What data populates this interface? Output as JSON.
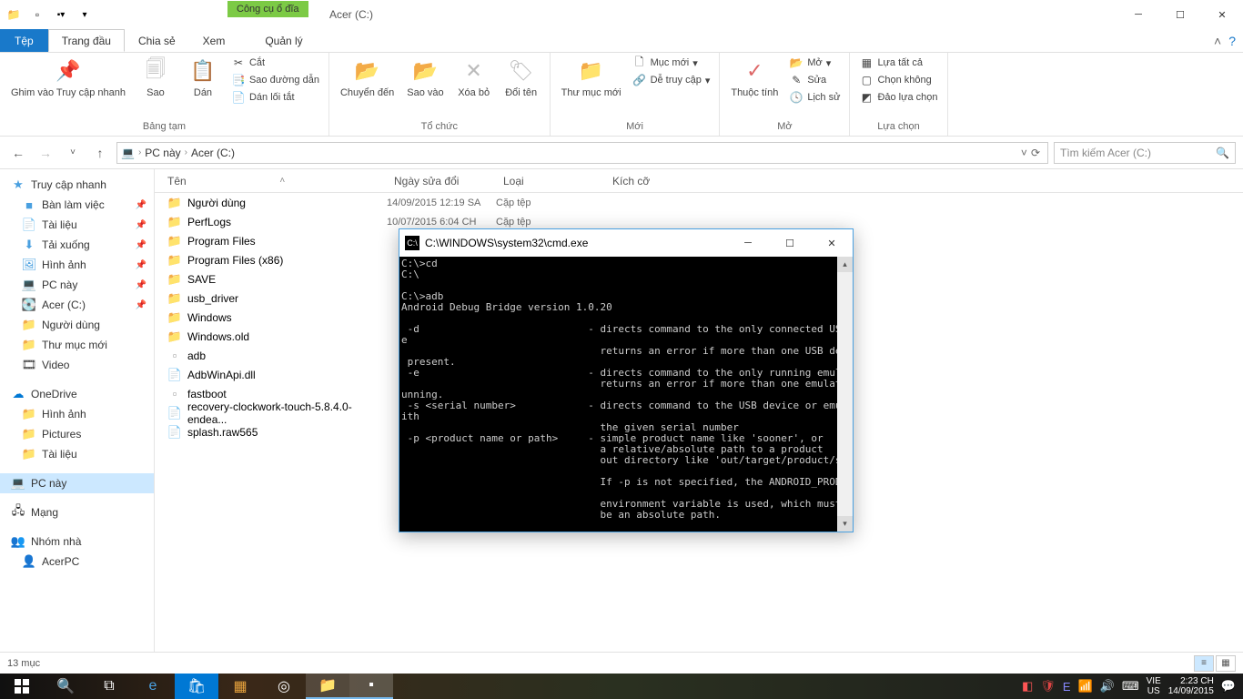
{
  "titlebar": {
    "drive_tools": "Công cụ ổ đĩa",
    "title": "Acer (C:)"
  },
  "tabs": {
    "file": "Tệp",
    "home": "Trang đầu",
    "share": "Chia sẻ",
    "view": "Xem",
    "manage": "Quản lý"
  },
  "ribbon": {
    "clipboard": {
      "title": "Bảng tạm",
      "pin": "Ghim vào Truy cập nhanh",
      "copy": "Sao",
      "paste": "Dán",
      "cut": "Cắt",
      "copy_path": "Sao đường dẫn",
      "paste_shortcut": "Dán lối tắt"
    },
    "organize": {
      "title": "Tổ chức",
      "move_to": "Chuyển đến",
      "copy_to": "Sao vào",
      "delete": "Xóa bỏ",
      "rename": "Đổi tên"
    },
    "new": {
      "title": "Mới",
      "new_folder": "Thư mục mới",
      "new_item": "Mục mới",
      "easy_access": "Dễ truy cập"
    },
    "open": {
      "title": "Mở",
      "properties": "Thuộc tính",
      "open": "Mở",
      "edit": "Sửa",
      "history": "Lịch sử"
    },
    "select": {
      "title": "Lựa chọn",
      "select_all": "Lựa tất cả",
      "select_none": "Chọn không",
      "invert": "Đảo lựa chọn"
    }
  },
  "breadcrumb": {
    "pc": "PC này",
    "drive": "Acer (C:)"
  },
  "search": {
    "placeholder": "Tìm kiếm Acer (C:)"
  },
  "sidebar": {
    "quick_access": "Truy cập nhanh",
    "desktop": "Bàn làm việc",
    "documents": "Tài liệu",
    "downloads": "Tải xuống",
    "pictures": "Hình ảnh",
    "this_pc": "PC này",
    "acer_c": "Acer (C:)",
    "users": "Người dùng",
    "new_folder": "Thư mục mới",
    "video": "Video",
    "onedrive": "OneDrive",
    "od_pictures": "Hình ảnh",
    "od_pictures2": "Pictures",
    "od_documents": "Tài liệu",
    "this_pc2": "PC này",
    "network": "Mạng",
    "homegroup": "Nhóm nhà",
    "acerpc": "AcerPC"
  },
  "columns": {
    "name": "Tên",
    "date": "Ngày sửa đổi",
    "type": "Loại",
    "size": "Kích cỡ"
  },
  "files": [
    {
      "name": "Người dùng",
      "date": "14/09/2015 12:19 SA",
      "type": "Cặp tệp",
      "icon": "folder"
    },
    {
      "name": "PerfLogs",
      "date": "10/07/2015 6:04 CH",
      "type": "Cặp tệp",
      "icon": "folder"
    },
    {
      "name": "Program Files",
      "date": "",
      "type": "",
      "icon": "folder"
    },
    {
      "name": "Program Files (x86)",
      "date": "",
      "type": "",
      "icon": "folder"
    },
    {
      "name": "SAVE",
      "date": "",
      "type": "",
      "icon": "folder"
    },
    {
      "name": "usb_driver",
      "date": "",
      "type": "",
      "icon": "folder"
    },
    {
      "name": "Windows",
      "date": "",
      "type": "",
      "icon": "folder"
    },
    {
      "name": "Windows.old",
      "date": "",
      "type": "",
      "icon": "folder"
    },
    {
      "name": "adb",
      "date": "",
      "type": "",
      "icon": "exe"
    },
    {
      "name": "AdbWinApi.dll",
      "date": "",
      "type": "",
      "icon": "file"
    },
    {
      "name": "fastboot",
      "date": "",
      "type": "",
      "icon": "exe"
    },
    {
      "name": "recovery-clockwork-touch-5.8.4.0-endea...",
      "date": "",
      "type": "",
      "icon": "file"
    },
    {
      "name": "splash.raw565",
      "date": "",
      "type": "",
      "icon": "file"
    }
  ],
  "status": {
    "count": "13 mục"
  },
  "cmd": {
    "title": "C:\\WINDOWS\\system32\\cmd.exe",
    "text": "C:\\>cd\nC:\\\n\nC:\\>adb\nAndroid Debug Bridge version 1.0.20\n\n -d                            - directs command to the only connected USB devic\ne\n                                 returns an error if more than one USB device is\n present.\n -e                            - directs command to the only running emulator.\n                                 returns an error if more than one emulator is r\nunning.\n -s <serial number>            - directs command to the USB device or emulator w\nith\n                                 the given serial number\n -p <product name or path>     - simple product name like 'sooner', or\n                                 a relative/absolute path to a product\n                                 out directory like 'out/target/product/sooner'.\n\n                                 If -p is not specified, the ANDROID_PRODUCT_OUT\n\n                                 environment variable is used, which must\n                                 be an absolute path."
  },
  "taskbar": {
    "lang1": "VIE",
    "lang2": "US",
    "time": "2:23 CH",
    "date": "14/09/2015"
  }
}
